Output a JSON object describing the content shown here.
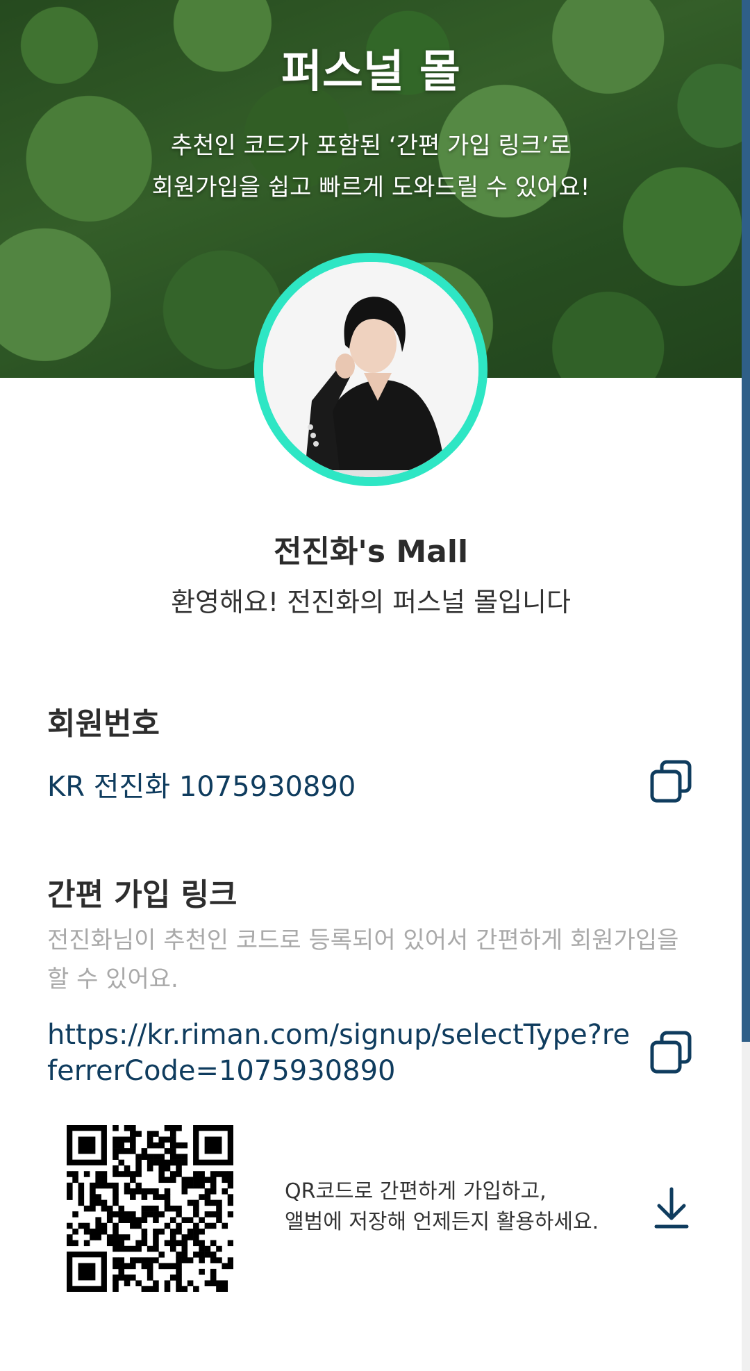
{
  "hero": {
    "title": "퍼스널 몰",
    "subtitle_line1": "추천인 코드가 포함된 ‘간편 가입 링크’로",
    "subtitle_line2": "회원가입을 쉽고 빠르게 도와드릴 수 있어요!"
  },
  "profile": {
    "mall_name": "전진화's Mall",
    "welcome": "환영해요! 전진화의 퍼스널 몰입니다",
    "avatar_icon": "profile-photo"
  },
  "member": {
    "title": "회원번호",
    "value": "KR 전진화 1075930890",
    "copy_icon": "copy-icon"
  },
  "signup_link": {
    "title": "간편 가입 링크",
    "description": "전진화님이 추천인 코드로 등록되어 있어서 간편하게 회원가입을 할 수 있어요.",
    "url": "https://kr.riman.com/signup/selectType?referrerCode=1075930890",
    "copy_icon": "copy-icon"
  },
  "qr": {
    "note_line1": "QR코드로 간편하게 가입하고,",
    "note_line2": "앨범에 저장해 언제든지 활용하세요.",
    "download_icon": "download-icon"
  },
  "colors": {
    "accent_ring": "#2ee6c4",
    "link_text": "#0f3c5e",
    "muted_text": "#a9a9a9",
    "scroll_thumb": "#2f5f88"
  }
}
